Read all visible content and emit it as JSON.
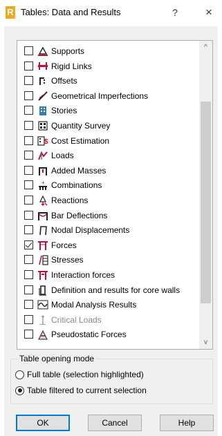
{
  "window": {
    "title": "Tables: Data and Results",
    "help_label": "?",
    "close_label": "×",
    "app_icon_letter": "R"
  },
  "list": {
    "items": [
      {
        "label": "Supports",
        "checked": false,
        "icon": "supports-icon",
        "disabled": false
      },
      {
        "label": "Rigid Links",
        "checked": false,
        "icon": "rigid-links-icon",
        "disabled": false
      },
      {
        "label": "Offsets",
        "checked": false,
        "icon": "offsets-icon",
        "disabled": false
      },
      {
        "label": "Geometrical Imperfections",
        "checked": false,
        "icon": "geometrical-imperfections-icon",
        "disabled": false
      },
      {
        "label": "Stories",
        "checked": false,
        "icon": "stories-icon",
        "disabled": false
      },
      {
        "label": "Quantity Survey",
        "checked": false,
        "icon": "quantity-survey-icon",
        "disabled": false
      },
      {
        "label": "Cost Estimation",
        "checked": false,
        "icon": "cost-estimation-icon",
        "disabled": false
      },
      {
        "label": "Loads",
        "checked": false,
        "icon": "loads-icon",
        "disabled": false
      },
      {
        "label": "Added Masses",
        "checked": false,
        "icon": "added-masses-icon",
        "disabled": false
      },
      {
        "label": "Combinations",
        "checked": false,
        "icon": "combinations-icon",
        "disabled": false
      },
      {
        "label": "Reactions",
        "checked": false,
        "icon": "reactions-icon",
        "disabled": false
      },
      {
        "label": "Bar Deflections",
        "checked": false,
        "icon": "bar-deflections-icon",
        "disabled": false
      },
      {
        "label": "Nodal Displacements",
        "checked": false,
        "icon": "nodal-displacements-icon",
        "disabled": false
      },
      {
        "label": "Forces",
        "checked": true,
        "icon": "forces-icon",
        "disabled": false
      },
      {
        "label": "Stresses",
        "checked": false,
        "icon": "stresses-icon",
        "disabled": false
      },
      {
        "label": "Interaction forces",
        "checked": false,
        "icon": "interaction-forces-icon",
        "disabled": false
      },
      {
        "label": "Definition and results for core walls",
        "checked": false,
        "icon": "core-walls-icon",
        "disabled": false
      },
      {
        "label": "Modal Analysis Results",
        "checked": false,
        "icon": "modal-analysis-icon",
        "disabled": false
      },
      {
        "label": "Critical Loads",
        "checked": false,
        "icon": "critical-loads-icon",
        "disabled": true
      },
      {
        "label": "Pseudostatic Forces",
        "checked": false,
        "icon": "pseudostatic-forces-icon",
        "disabled": false
      }
    ],
    "scroll_up": "^",
    "scroll_down": "v"
  },
  "opening_mode": {
    "legend": "Table opening mode",
    "options": [
      {
        "label": "Full table (selection highlighted)",
        "selected": false
      },
      {
        "label": "Table filtered to current selection",
        "selected": true
      }
    ]
  },
  "buttons": {
    "ok": "OK",
    "cancel": "Cancel",
    "help": "Help"
  },
  "colors": {
    "accent": "#0078d7",
    "dialog_bg": "#f0f0f0",
    "icon_red": "#c0102e",
    "app_icon": "#f0a81c"
  }
}
